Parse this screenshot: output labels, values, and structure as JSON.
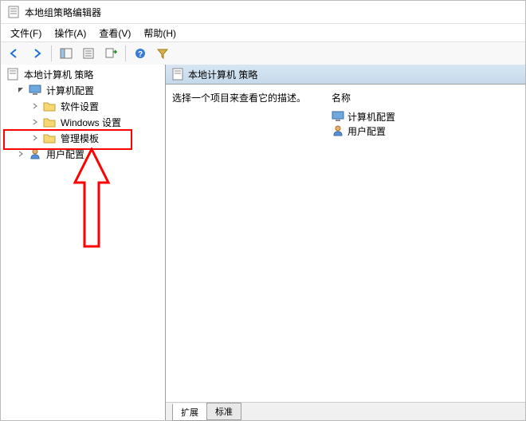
{
  "window_title": "本地组策略编辑器",
  "menu": {
    "file": "文件(F)",
    "action": "操作(A)",
    "view": "查看(V)",
    "help": "帮助(H)"
  },
  "tree": {
    "root": "本地计算机 策略",
    "computer_config": "计算机配置",
    "software_settings": "软件设置",
    "windows_settings": "Windows 设置",
    "admin_templates": "管理模板",
    "user_config": "用户配置"
  },
  "right": {
    "header": "本地计算机 策略",
    "description": "选择一个项目来查看它的描述。",
    "name_header": "名称",
    "item_computer": "计算机配置",
    "item_user": "用户配置"
  },
  "tabs": {
    "extended": "扩展",
    "standard": "标准"
  }
}
